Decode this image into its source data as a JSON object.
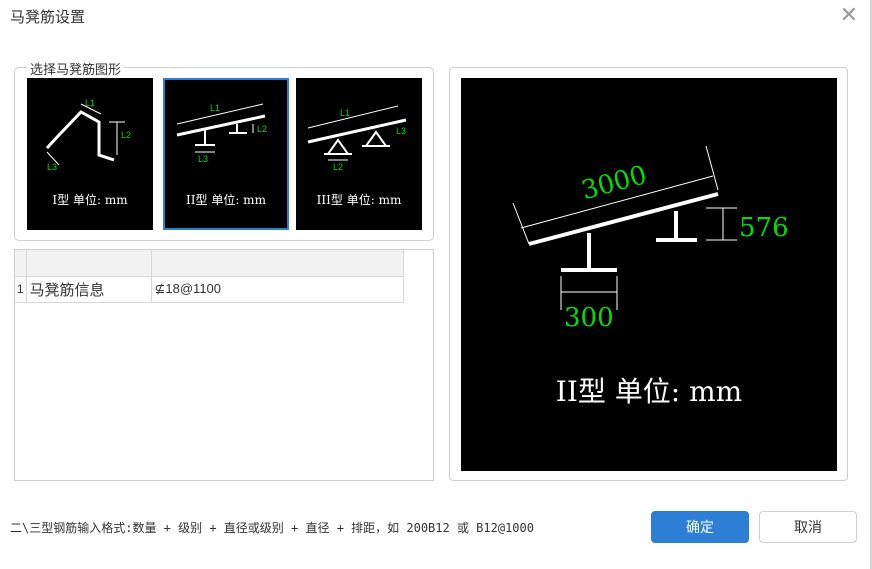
{
  "window": {
    "title": "马凳筋设置",
    "close_glyph": "✕"
  },
  "shape_group": {
    "label": "选择马凳筋图形",
    "options": [
      {
        "caption": "I型 单位: mm",
        "selected": false,
        "labels": [
          "L1",
          "L2",
          "L3"
        ]
      },
      {
        "caption": "II型 单位: mm",
        "selected": true,
        "labels": [
          "L1",
          "L2",
          "L3"
        ]
      },
      {
        "caption": "III型 单位: mm",
        "selected": false,
        "labels": [
          "L1",
          "L2",
          "L3"
        ]
      }
    ]
  },
  "table": {
    "rows": [
      {
        "num": "1",
        "name": "马凳筋信息",
        "value": "⊈18@1100"
      }
    ]
  },
  "preview": {
    "dim_length": "3000",
    "dim_height": "576",
    "dim_base": "300",
    "caption": "II型 单位: mm"
  },
  "footer": {
    "hint": "二\\三型钢筋输入格式:数量 + 级别 + 直径或级别 + 直径 + 排距，如 200B12 或 B12@1000",
    "ok_label": "确定",
    "cancel_label": "取消"
  },
  "colors": {
    "accent": "#2d7fd6",
    "dim_green": "#00e000"
  }
}
